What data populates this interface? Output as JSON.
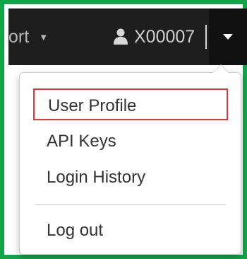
{
  "navbar": {
    "partial_item_label": "ort",
    "user_label": "X00007"
  },
  "dropdown": {
    "items": [
      {
        "label": "User Profile",
        "highlighted": true
      },
      {
        "label": "API Keys"
      },
      {
        "label": "Login History"
      }
    ],
    "logout_label": "Log out"
  },
  "colors": {
    "frame_border": "#13a449",
    "navbar_bg": "#1e1e1e",
    "highlight_border": "#d83b3b"
  },
  "icons": {
    "user": "user-icon",
    "caret": "caret-down-icon"
  }
}
